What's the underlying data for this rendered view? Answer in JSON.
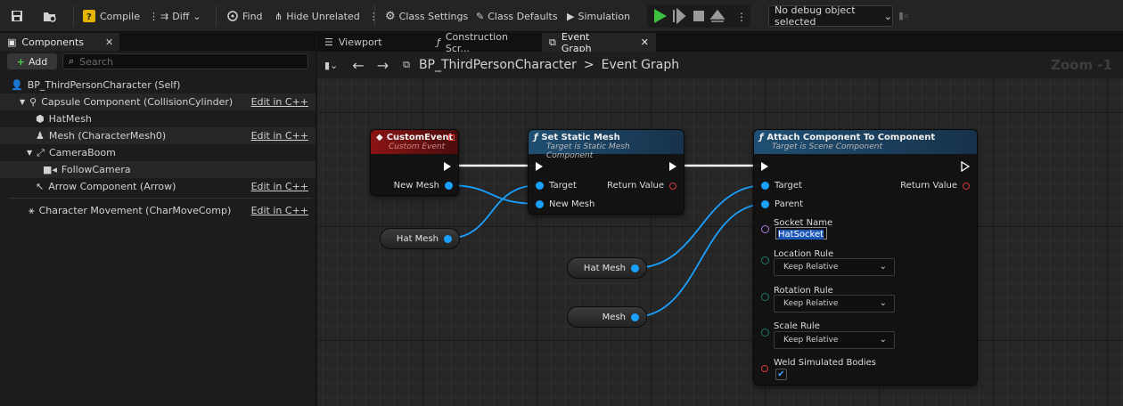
{
  "toolbar": {
    "compile_label": "Compile",
    "diff_label": "Diff",
    "find_label": "Find",
    "hide_unrelated_label": "Hide Unrelated",
    "class_settings_label": "Class Settings",
    "class_defaults_label": "Class Defaults",
    "simulation_label": "Simulation",
    "debug_object_label": "No debug object selected"
  },
  "left_panel": {
    "tab_label": "Components",
    "add_label": "Add",
    "search_placeholder": "Search",
    "edit_cpp_label": "Edit in C++",
    "items": [
      {
        "label": "BP_ThirdPersonCharacter (Self)",
        "icon": "person-icon"
      },
      {
        "label": "Capsule Component (CollisionCylinder)",
        "icon": "capsule-icon"
      },
      {
        "label": "HatMesh",
        "icon": "cube-icon"
      },
      {
        "label": "Mesh (CharacterMesh0)",
        "icon": "skeletal-mesh-icon"
      },
      {
        "label": "CameraBoom",
        "icon": "spring-arm-icon"
      },
      {
        "label": "FollowCamera",
        "icon": "camera-icon"
      },
      {
        "label": "Arrow Component (Arrow)",
        "icon": "arrow-icon"
      },
      {
        "label": "Character Movement (CharMoveComp)",
        "icon": "movement-icon"
      }
    ]
  },
  "graph_tabs": [
    {
      "label": "Viewport"
    },
    {
      "label": "Construction Scr..."
    },
    {
      "label": "Event Graph"
    }
  ],
  "breadcrumb": {
    "blueprint": "BP_ThirdPersonCharacter",
    "separator": ">",
    "graph": "Event Graph",
    "zoom": "Zoom -1"
  },
  "nodes": {
    "custom_event": {
      "title": "CustomEvent",
      "subtitle": "Custom Event",
      "pin_new_mesh": "New Mesh"
    },
    "set_static_mesh": {
      "title": "Set Static Mesh",
      "subtitle": "Target is Static Mesh Component",
      "pin_target": "Target",
      "pin_new_mesh": "New Mesh",
      "pin_return": "Return Value"
    },
    "attach": {
      "title": "Attach Component To Component",
      "subtitle": "Target is Scene Component",
      "pin_target": "Target",
      "pin_parent": "Parent",
      "pin_return": "Return Value",
      "socket_name_label": "Socket Name",
      "socket_name_value": "HatSocket",
      "location_rule_label": "Location Rule",
      "location_rule_value": "Keep Relative",
      "rotation_rule_label": "Rotation Rule",
      "rotation_rule_value": "Keep Relative",
      "scale_rule_label": "Scale Rule",
      "scale_rule_value": "Keep Relative",
      "weld_label": "Weld Simulated Bodies",
      "weld_checked": "true"
    },
    "var_hat_mesh_1": {
      "label": "Hat Mesh"
    },
    "var_hat_mesh_2": {
      "label": "Hat Mesh"
    },
    "var_mesh": {
      "label": "Mesh"
    }
  },
  "colors": {
    "event_header": "#8a1414",
    "function_header": "#1f4f73",
    "object_pin": "#1aa0ff",
    "exec_wire": "#ffffff"
  }
}
